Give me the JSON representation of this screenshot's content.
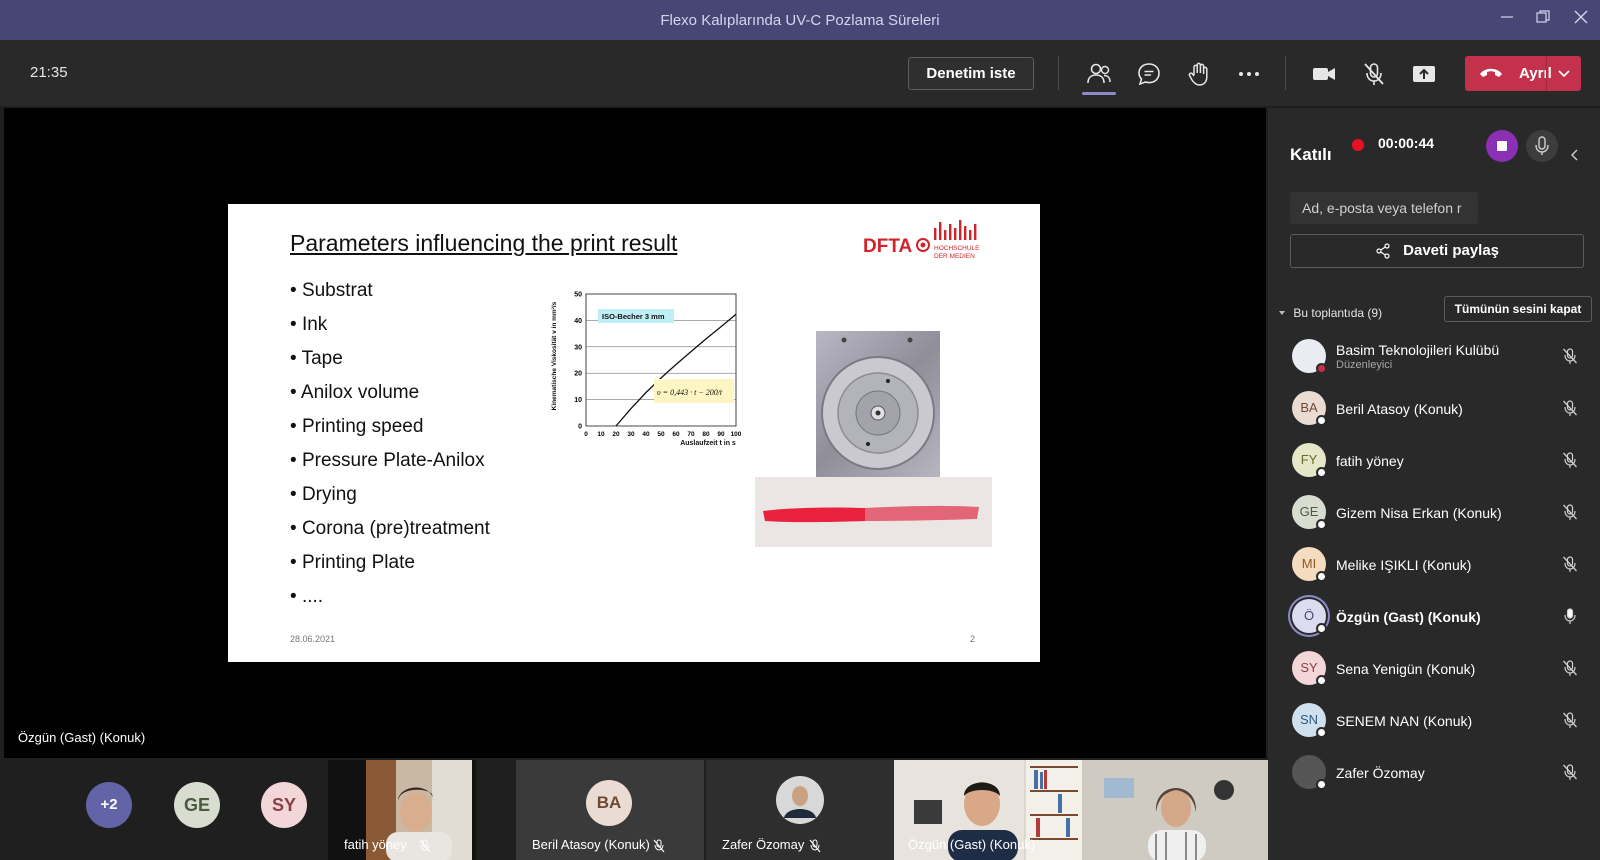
{
  "window": {
    "title": "Flexo Kalıplarında UV-C Pozlama Süreleri"
  },
  "toolbar": {
    "clock": "21:35",
    "control_request": "Denetim iste",
    "leave_label": "Ayrıl"
  },
  "slide": {
    "title": "Parameters influencing the print result",
    "bullets": [
      "Substrat",
      "Ink",
      "Tape",
      "Anilox volume",
      "Printing speed",
      "Pressure Plate-Anilox",
      "Drying",
      "Corona (pre)treatment",
      "Printing Plate",
      "...."
    ],
    "date": "28.06.2021",
    "page": "2",
    "logo_text": "DFTA",
    "logo_sub1": "HOCHSCHULE",
    "logo_sub2": "DER MEDIEN",
    "chart_annotation": "ISO-Becher 3 mm",
    "chart_formula": "υ = 0,443 · t − 200/t"
  },
  "chart_data": {
    "type": "line",
    "x": [
      20,
      30,
      40,
      50,
      60,
      70,
      80,
      90,
      100
    ],
    "series": [
      {
        "values": [
          0,
          6.6,
          12.7,
          18.2,
          23.3,
          28.2,
          33.0,
          37.6,
          42.3
        ]
      }
    ],
    "xlabel": "Auslaufzeit t in s",
    "ylabel": "Kinematische Viskosität v in mm²/s",
    "x_ticks": [
      "0",
      "10",
      "20",
      "30",
      "40",
      "50",
      "60",
      "70",
      "80",
      "90",
      "100"
    ],
    "y_ticks": [
      "0",
      "10",
      "20",
      "30",
      "40",
      "50"
    ],
    "xlim": [
      0,
      100
    ],
    "ylim": [
      0,
      50
    ],
    "grid": true
  },
  "stage": {
    "label": "Özgün (Gast) (Konuk)"
  },
  "strip": {
    "overflow": "+2",
    "circles": [
      {
        "initials": "GE",
        "bg": "#d9ddd0",
        "fg": "#4c5a41"
      },
      {
        "initials": "SY",
        "bg": "#f3d6d8",
        "fg": "#8a3f47"
      }
    ],
    "tiles": [
      {
        "name": "fatih yöney"
      },
      {
        "name": "Beril Atasoy (Konuk)",
        "initials": "BA"
      },
      {
        "name": "Zafer Özomay"
      },
      {
        "name": "Özgün (Gast) (Konuk)"
      }
    ]
  },
  "panel": {
    "title": "Katılı",
    "rec_time": "00:00:44",
    "search_placeholder": "Ad, e-posta veya telefon r",
    "share_label": "Daveti paylaş",
    "section": "Bu toplantıda (9)",
    "mute_all": "Tümünün sesini kapat",
    "participants": [
      {
        "name": "Basim Teknolojileri Kulübü",
        "role": "Düzenleyici",
        "initials": "",
        "bg": "#e9ecf2",
        "fg": "#1b3a78",
        "muted": true
      },
      {
        "name": "Beril Atasoy (Konuk)",
        "initials": "BA",
        "bg": "#eadcd2",
        "fg": "#6d4a36",
        "muted": true
      },
      {
        "name": "fatih yöney",
        "initials": "FY",
        "bg": "#e5e7c9",
        "fg": "#6a6a2c",
        "muted": true
      },
      {
        "name": "Gizem Nisa Erkan (Konuk)",
        "initials": "GE",
        "bg": "#d9ddd0",
        "fg": "#4c5a41",
        "muted": true
      },
      {
        "name": "Melike IŞIKLI (Konuk)",
        "initials": "MI",
        "bg": "#f4dcc0",
        "fg": "#8a5a21",
        "muted": true
      },
      {
        "name": "Özgün (Gast) (Konuk)",
        "initials": "Ö",
        "bg": "#dcdcf0",
        "fg": "#464775",
        "muted": false
      },
      {
        "name": "Sena Yenigün (Konuk)",
        "initials": "SY",
        "bg": "#f3d6d8",
        "fg": "#8a3f47",
        "muted": true
      },
      {
        "name": "SENEM NAN (Konuk)",
        "initials": "SN",
        "bg": "#cfe1ef",
        "fg": "#2d5c7f",
        "muted": true
      },
      {
        "name": "Zafer Özomay",
        "initials": "",
        "bg": "#555555",
        "fg": "#ffffff",
        "muted": true
      }
    ]
  }
}
